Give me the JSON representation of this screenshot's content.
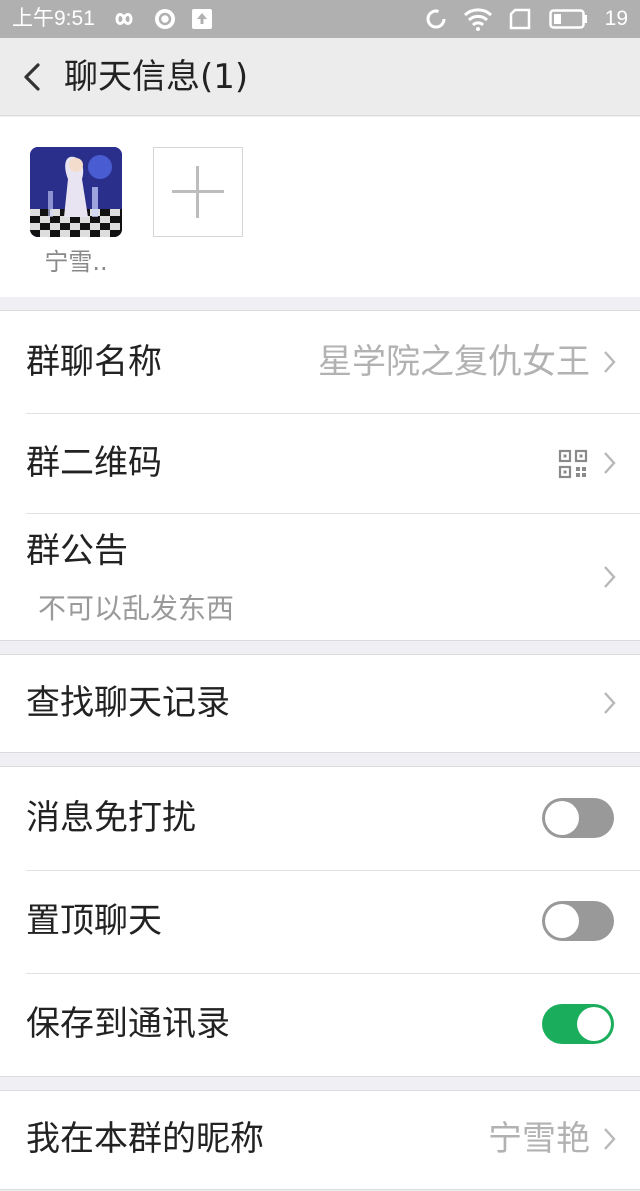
{
  "status_bar": {
    "time": "上午9:51",
    "battery": "19"
  },
  "header": {
    "title": "聊天信息(1)"
  },
  "members": [
    {
      "name": "宁雪.."
    }
  ],
  "group_info": {
    "name_label": "群聊名称",
    "name_value": "星学院之复仇女王",
    "qr_label": "群二维码",
    "notice_label": "群公告",
    "notice_value": "不可以乱发东西"
  },
  "search": {
    "label": "查找聊天记录"
  },
  "settings": {
    "mute_label": "消息免打扰",
    "mute_on": false,
    "pin_label": "置顶聊天",
    "pin_on": false,
    "save_label": "保存到通讯录",
    "save_on": true
  },
  "nickname": {
    "label": "我在本群的昵称",
    "value": "宁雪艳"
  },
  "colors": {
    "toggle_on": "#1aad5b",
    "toggle_off": "#999999"
  }
}
